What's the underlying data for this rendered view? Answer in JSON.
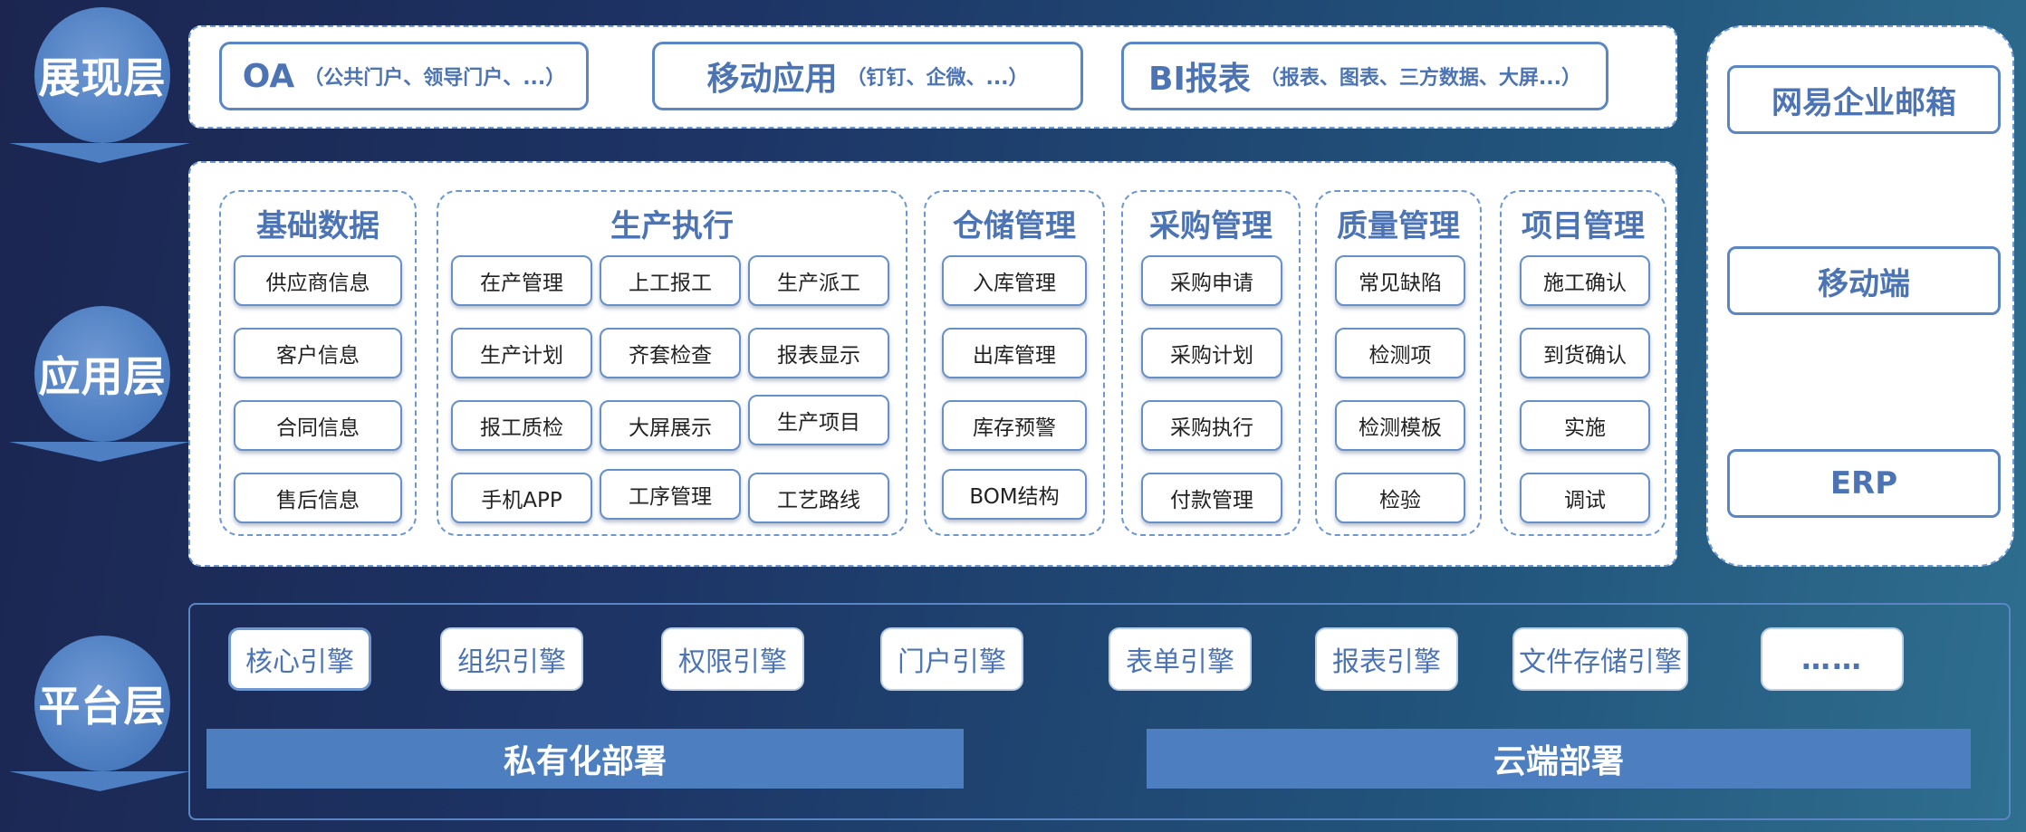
{
  "layers": {
    "presentation": "展现层",
    "application": "应用层",
    "platform": "平台层"
  },
  "presentation": {
    "oa": {
      "main": "OA",
      "sub": "（公共门户、领导门户、...）"
    },
    "mobile": {
      "main": "移动应用",
      "sub": "（钉钉、企微、...）"
    },
    "bi": {
      "main": "BI报表",
      "sub": "（报表、图表、三方数据、大屏...）"
    }
  },
  "application": {
    "groups": [
      {
        "title": "基础数据",
        "items": [
          "供应商信息",
          "客户信息",
          "合同信息",
          "售后信息"
        ]
      },
      {
        "title": "生产执行",
        "items": [
          "在产管理",
          "上工报工",
          "生产派工",
          "生产计划",
          "齐套检查",
          "报表显示",
          "报工质检",
          "大屏展示",
          "生产项目",
          "手机APP",
          "工序管理",
          "工艺路线"
        ]
      },
      {
        "title": "仓储管理",
        "items": [
          "入库管理",
          "出库管理",
          "库存预警",
          "BOM结构"
        ]
      },
      {
        "title": "采购管理",
        "items": [
          "采购申请",
          "采购计划",
          "采购执行",
          "付款管理"
        ]
      },
      {
        "title": "质量管理",
        "items": [
          "常见缺陷",
          "检测项",
          "检测模板",
          "检验"
        ]
      },
      {
        "title": "项目管理",
        "items": [
          "施工确认",
          "到货确认",
          "实施",
          "调试"
        ]
      }
    ]
  },
  "right_panel": {
    "items": [
      "网易企业邮箱",
      "移动端",
      "ERP"
    ]
  },
  "platform": {
    "engines": [
      "核心引擎",
      "组织引擎",
      "权限引擎",
      "门户引擎",
      "表单引擎",
      "报表引擎",
      "文件存储引擎",
      "……"
    ],
    "deploy": [
      "私有化部署",
      "云端部署"
    ]
  },
  "colors": {
    "accent": "#4c74b4",
    "circle": "#4e7fc2",
    "deploy_bar": "#4d7fc0"
  }
}
